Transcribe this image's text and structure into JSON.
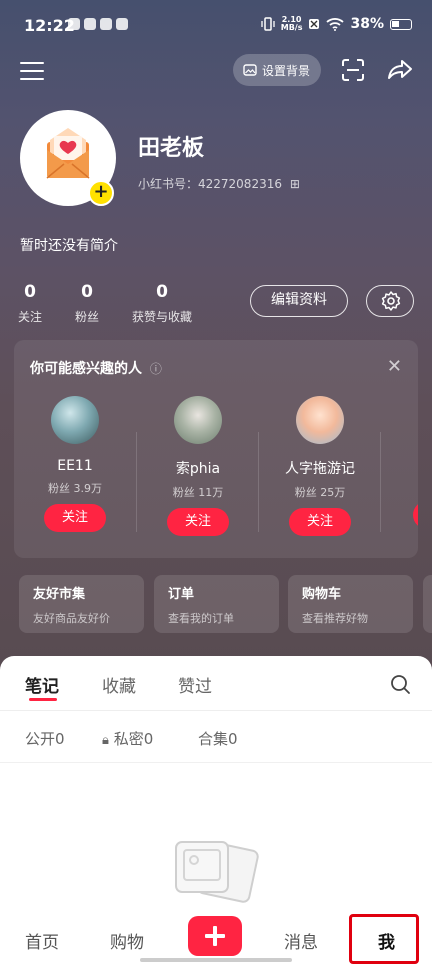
{
  "status_bar": {
    "time": "12:22",
    "net_speed_top": "2.10",
    "net_speed_bottom": "MB/s",
    "battery": "38%"
  },
  "topbar": {
    "set_background": "设置背景"
  },
  "profile": {
    "name": "田老板",
    "redbook_id": "小红书号：42272082316",
    "bio": "暂时还没有简介",
    "stats": [
      {
        "num": "0",
        "label": "关注"
      },
      {
        "num": "0",
        "label": "粉丝"
      },
      {
        "num": "0",
        "label": "获赞与收藏"
      }
    ],
    "edit_label": "编辑资料"
  },
  "recommend": {
    "title": "你可能感兴趣的人",
    "people": [
      {
        "name": "EE11",
        "fans": "粉丝 3.9万",
        "follow": "关注"
      },
      {
        "name": "索phia",
        "fans": "粉丝 11万",
        "follow": "关注"
      },
      {
        "name": "人字拖游记",
        "fans": "粉丝 25万",
        "follow": "关注"
      }
    ]
  },
  "shortcuts": [
    {
      "title": "友好市集",
      "sub": "友好商品友好价"
    },
    {
      "title": "订单",
      "sub": "查看我的订单"
    },
    {
      "title": "购物车",
      "sub": "查看推荐好物"
    }
  ],
  "tabs": [
    "笔记",
    "收藏",
    "赞过"
  ],
  "subtabs": [
    "公开0",
    "私密0",
    "合集0"
  ],
  "nav": {
    "home": "首页",
    "shop": "购物",
    "messages": "消息",
    "me": "我"
  },
  "colors": {
    "accent": "#ff2442",
    "highlight_box": "#e0000f",
    "avatar_badge": "#ffe100"
  }
}
